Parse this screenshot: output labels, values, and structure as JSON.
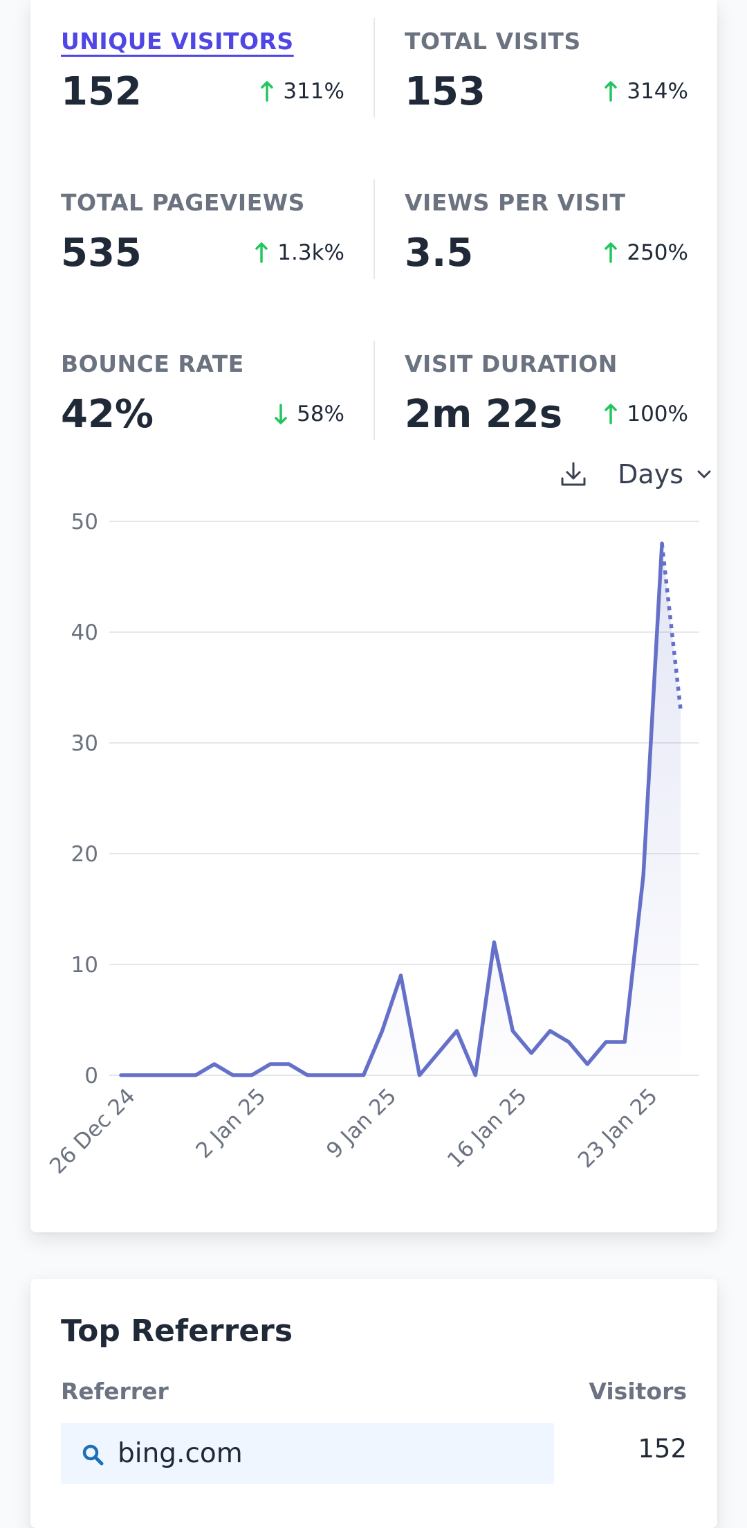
{
  "metrics": [
    {
      "label": "UNIQUE VISITORS",
      "value": "152",
      "change": "311%",
      "direction": "up",
      "active": true
    },
    {
      "label": "TOTAL VISITS",
      "value": "153",
      "change": "314%",
      "direction": "up",
      "active": false
    },
    {
      "label": "TOTAL PAGEVIEWS",
      "value": "535",
      "change": "1.3k%",
      "direction": "up",
      "active": false
    },
    {
      "label": "VIEWS PER VISIT",
      "value": "3.5",
      "change": "250%",
      "direction": "up",
      "active": false
    },
    {
      "label": "BOUNCE RATE",
      "value": "42%",
      "change": "58%",
      "direction": "down",
      "active": false
    },
    {
      "label": "VISIT DURATION",
      "value": "2m 22s",
      "change": "100%",
      "direction": "up",
      "active": false
    }
  ],
  "toolbar": {
    "interval_label": "Days",
    "download_icon": "download-icon",
    "chevron_icon": "chevron-down-icon"
  },
  "colors": {
    "accent": "#4f46e5",
    "line": "#6571c9",
    "up": "#22c55e",
    "down": "#22c55e"
  },
  "chart_data": {
    "type": "line",
    "title": "",
    "xlabel": "",
    "ylabel": "",
    "ylim": [
      0,
      50
    ],
    "yticks": [
      0,
      10,
      20,
      30,
      40,
      50
    ],
    "grid": true,
    "x": [
      "26 Dec 24",
      "27 Dec 24",
      "28 Dec 24",
      "29 Dec 24",
      "30 Dec 24",
      "31 Dec 24",
      "1 Jan 25",
      "2 Jan 25",
      "3 Jan 25",
      "4 Jan 25",
      "5 Jan 25",
      "6 Jan 25",
      "7 Jan 25",
      "8 Jan 25",
      "9 Jan 25",
      "10 Jan 25",
      "11 Jan 25",
      "12 Jan 25",
      "13 Jan 25",
      "14 Jan 25",
      "15 Jan 25",
      "16 Jan 25",
      "17 Jan 25",
      "18 Jan 25",
      "19 Jan 25",
      "20 Jan 25",
      "21 Jan 25",
      "22 Jan 25",
      "23 Jan 25",
      "24 Jan 25",
      "25 Jan 25",
      "26 Jan 25"
    ],
    "xtick_labels": [
      "26 Dec 24",
      "2 Jan 25",
      "9 Jan 25",
      "16 Jan 25",
      "23 Jan 25"
    ],
    "series": [
      {
        "values": [
          0,
          0,
          0,
          0,
          0,
          1,
          0,
          0,
          1,
          1,
          0,
          0,
          0,
          0,
          4,
          9,
          0,
          2,
          4,
          0,
          12,
          4,
          2,
          4,
          3,
          1,
          3,
          3,
          18,
          48
        ],
        "partial_last": 33
      }
    ]
  },
  "referrers": {
    "title": "Top Referrers",
    "col_referrer": "Referrer",
    "col_visitors": "Visitors",
    "rows": [
      {
        "name": "bing.com",
        "visitors": "152",
        "icon": "search-icon"
      }
    ]
  }
}
